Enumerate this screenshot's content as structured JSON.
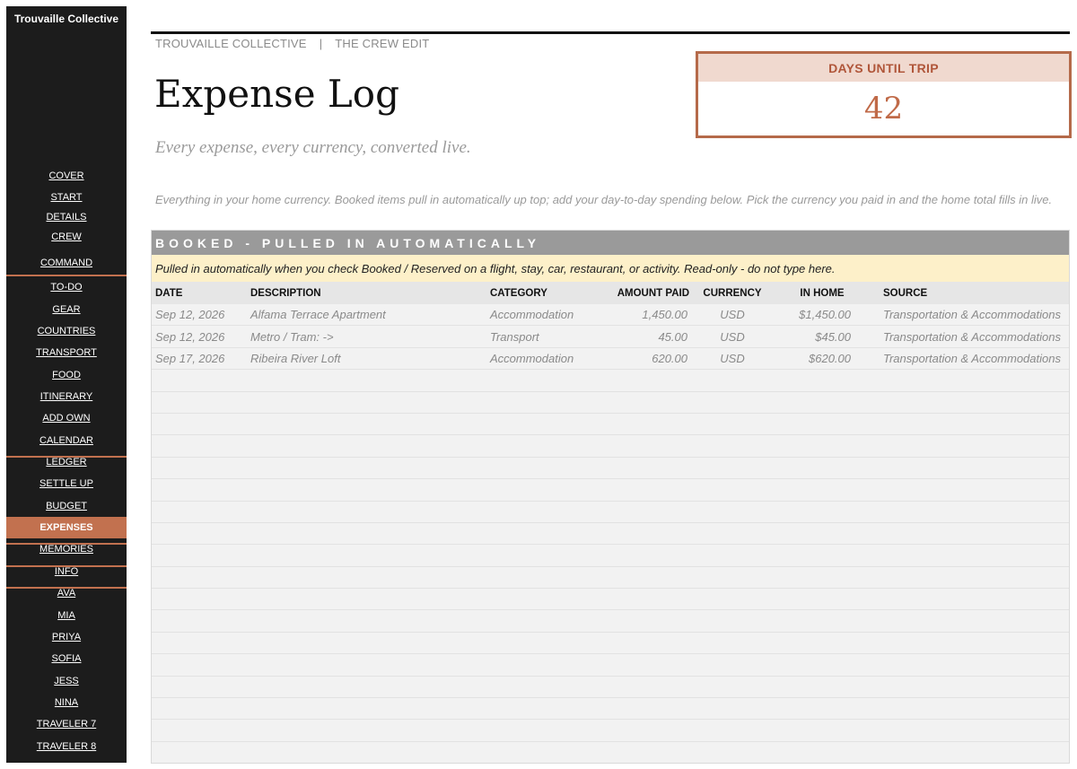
{
  "sidebar": {
    "brand": "Trouvaille Collective",
    "items": [
      {
        "label": "COVER"
      },
      {
        "label": "START"
      },
      {
        "label": "DETAILS"
      },
      {
        "label": "CREW"
      },
      {
        "label": "COMMAND"
      },
      {
        "label": "TO-DO"
      },
      {
        "label": "GEAR"
      },
      {
        "label": "COUNTRIES"
      },
      {
        "label": "TRANSPORT"
      },
      {
        "label": "FOOD"
      },
      {
        "label": "ITINERARY"
      },
      {
        "label": "ADD OWN"
      },
      {
        "label": "CALENDAR"
      },
      {
        "label": "LEDGER"
      },
      {
        "label": "SETTLE UP"
      },
      {
        "label": "BUDGET"
      },
      {
        "label": "EXPENSES",
        "active": true
      },
      {
        "label": "MEMORIES"
      },
      {
        "label": "INFO"
      },
      {
        "label": "AVA"
      },
      {
        "label": "MIA"
      },
      {
        "label": "PRIYA"
      },
      {
        "label": "SOFIA"
      },
      {
        "label": "JESS"
      },
      {
        "label": "NINA"
      },
      {
        "label": "TRAVELER 7"
      },
      {
        "label": "TRAVELER 8"
      }
    ]
  },
  "header": {
    "breadcrumb_left": "TROUVAILLE COLLECTIVE",
    "breadcrumb_sep": "|",
    "breadcrumb_right": "THE CREW EDIT",
    "title": "Expense Log",
    "tagline": "Every expense, every currency, converted live.",
    "intro": "Everything in your home currency. Booked items pull in automatically up top; add your day-to-day spending below. Pick the currency you paid in and the home total fills in live."
  },
  "countdown": {
    "label": "DAYS UNTIL TRIP",
    "value": "42"
  },
  "booked": {
    "title": "BOOKED - PULLED IN AUTOMATICALLY",
    "notice": "Pulled in automatically when you check Booked / Reserved on a flight, stay, car, restaurant, or activity. Read-only - do not type here.",
    "columns": {
      "date": "DATE",
      "description": "DESCRIPTION",
      "category": "CATEGORY",
      "amount": "AMOUNT PAID",
      "currency": "CURRENCY",
      "home": "IN HOME",
      "source": "SOURCE"
    },
    "rows": [
      {
        "date": "Sep 12, 2026",
        "description": "Alfama Terrace Apartment",
        "category": "Accommodation",
        "amount": "1,450.00",
        "currency": "USD",
        "home": "$1,450.00",
        "source": "Transportation & Accommodations"
      },
      {
        "date": "Sep 12, 2026",
        "description": "Metro / Tram:  ->",
        "category": "Transport",
        "amount": "45.00",
        "currency": "USD",
        "home": "$45.00",
        "source": "Transportation & Accommodations"
      },
      {
        "date": "Sep 17, 2026",
        "description": "Ribeira River Loft",
        "category": "Accommodation",
        "amount": "620.00",
        "currency": "USD",
        "home": "$620.00",
        "source": "Transportation & Accommodations"
      }
    ]
  },
  "colors": {
    "sidebar_bg": "#1c1c1c",
    "accent": "#c2714f",
    "notice_bg": "#fdf0c9",
    "section_bar": "#9a9a9a"
  }
}
